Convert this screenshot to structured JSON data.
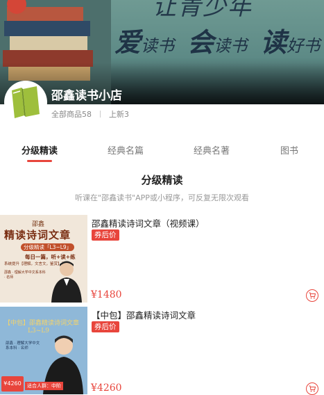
{
  "banner": {
    "slogan_top": "让青少年",
    "slogan_parts": [
      {
        "big": "爱",
        "small": "读书"
      },
      {
        "big": "会",
        "small": "读书"
      },
      {
        "big": "读",
        "small": "好书"
      }
    ]
  },
  "shop": {
    "name": "邵鑫读书小店",
    "total_products": "全部商品58",
    "new_items": "上新3"
  },
  "tabs": [
    {
      "label": "分级精读",
      "active": true
    },
    {
      "label": "经典名篇",
      "active": false
    },
    {
      "label": "经典名著",
      "active": false
    },
    {
      "label": "图书",
      "active": false
    }
  ],
  "section": {
    "title": "分级精读",
    "subtitle": "听课在\"邵鑫读书\"APP或小程序，可反复无限次观看"
  },
  "products": [
    {
      "title": "邵鑫精读诗词文章（视频课）",
      "coupon": "券后价",
      "price": "¥1480",
      "thumb": {
        "brand": "邵鑫",
        "title": "精读诗词文章",
        "pill": "分级精读「L3~L9」",
        "line1": "每日一篇，听+读+练",
        "line2": "系统提升【理解，文言文，鉴赏】三阶",
        "mini": "邵鑫 · 理解大学中文系本科 · 名师"
      }
    },
    {
      "title": "【中包】邵鑫精读诗词文章",
      "coupon": "券后价",
      "price": "¥4260",
      "thumb": {
        "title": "【中包】邵鑫精读诗词文章",
        "grade": "L3~L9",
        "info": "邵鑫 · 理解大学中文系本科 · 名师",
        "badge": "¥4260",
        "bottom": "适合人群：中阶"
      }
    }
  ],
  "colors": {
    "accent": "#e8453c",
    "logo_green": "#9ebf3c"
  }
}
